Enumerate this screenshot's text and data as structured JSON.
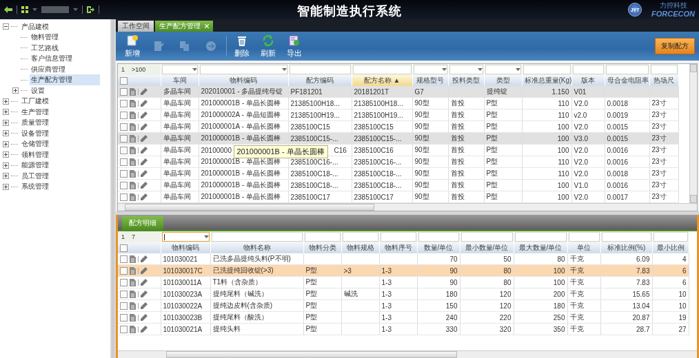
{
  "topbar": {
    "title": "智能制造执行系统",
    "logo_badge": "JYT",
    "brand_sub": "力控科技",
    "brand": "FORCECON"
  },
  "sidebar": {
    "items": [
      {
        "label": "产品建模",
        "expanded": true,
        "selected": false,
        "children": [
          {
            "label": "物料管理",
            "selected": false
          },
          {
            "label": "工艺路线",
            "selected": false
          },
          {
            "label": "客户信息管理",
            "selected": false
          },
          {
            "label": "供应商管理",
            "selected": false
          },
          {
            "label": "生产配方管理",
            "selected": true
          },
          {
            "label": "设置",
            "expanded": false,
            "selected": false
          }
        ]
      },
      {
        "label": "工厂建模",
        "expanded": false,
        "selected": false
      },
      {
        "label": "生产管理",
        "expanded": false,
        "selected": false
      },
      {
        "label": "质量管理",
        "expanded": false,
        "selected": false
      },
      {
        "label": "设备管理",
        "expanded": false,
        "selected": false
      },
      {
        "label": "仓储管理",
        "expanded": false,
        "selected": false
      },
      {
        "label": "领料管理",
        "expanded": false,
        "selected": false
      },
      {
        "label": "能源管理",
        "expanded": false,
        "selected": false
      },
      {
        "label": "员工管理",
        "expanded": false,
        "selected": false
      },
      {
        "label": "系统管理",
        "expanded": false,
        "selected": false
      }
    ]
  },
  "tabs": [
    {
      "label": "工作空间",
      "selected": false,
      "closable": false
    },
    {
      "label": "生产配方管理",
      "selected": true,
      "closable": true
    }
  ],
  "toolbar": {
    "buttons": [
      {
        "kind": "add",
        "label": "新增",
        "disabled": false
      },
      {
        "kind": "edit",
        "disabled": true
      },
      {
        "kind": "copy",
        "disabled": true
      },
      {
        "kind": "import",
        "disabled": true
      },
      {
        "kind": "delete",
        "label": "删除",
        "disabled": false
      },
      {
        "kind": "refresh",
        "label": "刷新",
        "disabled": false
      },
      {
        "kind": "export",
        "label": "导出",
        "disabled": false
      }
    ],
    "action": "复制配方"
  },
  "recipe_grid": {
    "all_checked": false,
    "pager": {
      "page": "1",
      "total": ">100"
    },
    "filters": [
      {
        "kind": "dropdown"
      },
      {
        "kind": "dropdown"
      },
      {
        "kind": "text"
      },
      {
        "kind": "text"
      },
      {
        "kind": "dropdown"
      },
      {
        "kind": "dropdown"
      },
      {
        "kind": "dropdown"
      },
      {
        "kind": "text"
      },
      {
        "kind": "text"
      },
      {
        "kind": "text"
      },
      {
        "kind": "text"
      }
    ],
    "columns": [
      {
        "label": "车间"
      },
      {
        "label": "物料编码"
      },
      {
        "label": "配方编码"
      },
      {
        "label": "配方名称",
        "sort_mark": "▲"
      },
      {
        "label": "规格型号"
      },
      {
        "label": "投料类型"
      },
      {
        "label": "类型"
      },
      {
        "label": "标准总重量(Kg)"
      },
      {
        "label": "版本"
      },
      {
        "label": "母合金电阻率"
      },
      {
        "label": "热场尺"
      }
    ],
    "rows": [
      {
        "checked": false,
        "selected": true,
        "cells": [
          "多晶车间",
          "202010001 - 多晶提纯母锭",
          "PF181201",
          "20181201T",
          "G7",
          "",
          "提纯锭",
          "1.150",
          "V01",
          "",
          ""
        ]
      },
      {
        "checked": false,
        "selected": false,
        "cells": [
          "单晶车间",
          "201000001B - 单晶长圆棒",
          "21385100H18...",
          "21385100H18...",
          "90型",
          "首投",
          "P型",
          "110",
          "V2.0",
          "0.0018",
          "23寸"
        ]
      },
      {
        "checked": false,
        "selected": false,
        "cells": [
          "单晶车间",
          "201000002A - 单晶短圆棒",
          "21385100H19...",
          "21385100H19...",
          "90型",
          "首投",
          "P型",
          "110",
          "v2.0",
          "0.0019",
          "23寸"
        ]
      },
      {
        "checked": false,
        "selected": false,
        "cells": [
          "单晶车间",
          "201000001A - 单晶长圆棒",
          "2385100C15",
          "2385100C15",
          "90型",
          "首投",
          "P型",
          "100",
          "V2.0",
          "0.0015",
          "23寸"
        ]
      },
      {
        "checked": false,
        "selected": true,
        "cells": [
          "单晶车间",
          "201000001B - 单晶长圆棒",
          "2385100C15-...",
          "2385100C15-...",
          "90型",
          "首投",
          "P型",
          "100",
          "V3.0",
          "0.0015",
          "23寸"
        ]
      },
      {
        "checked": false,
        "selected": false,
        "tooltip": "201000001B - 单晶长圆棒",
        "cells": [
          "单晶车间",
          "20100000",
          "C16",
          "2385100C16",
          "90型",
          "首投",
          "P型",
          "100",
          "V2.0",
          "0.0016",
          "23寸"
        ]
      },
      {
        "checked": false,
        "selected": false,
        "cells": [
          "单晶车间",
          "201000001B - 单晶长圆棒",
          "2385100C16-...",
          "2385100C16-...",
          "90型",
          "首投",
          "P型",
          "110",
          "V2.0",
          "0.0016",
          "23寸"
        ]
      },
      {
        "checked": false,
        "selected": false,
        "cells": [
          "单晶车间",
          "201000001B - 单晶长圆棒",
          "2385100C18-...",
          "2385100C18-...",
          "90型",
          "首投",
          "P型",
          "110",
          "V2.0",
          "0.0018",
          "23寸"
        ]
      },
      {
        "checked": false,
        "selected": false,
        "cells": [
          "单晶车间",
          "201000001B - 单晶长圆棒",
          "2385100C18-...",
          "2385100C18-...",
          "90型",
          "首投",
          "P型",
          "100",
          "V1.0",
          "0.0016",
          "23寸"
        ]
      },
      {
        "checked": false,
        "selected": false,
        "cells": [
          "单晶车间",
          "201000001B - 单晶长圆棒",
          "2385100C17",
          "2385100C17",
          "90型",
          "首投",
          "P型",
          "100",
          "V2.0",
          "0.0017",
          "23寸"
        ]
      }
    ]
  },
  "detail": {
    "tab": "配方明细",
    "grid": {
      "all_checked": false,
      "pager": {
        "page": "1",
        "total": "7"
      },
      "filters": [
        {
          "kind": "dropdown",
          "focused": true
        },
        {
          "kind": "text"
        },
        {
          "kind": "text"
        },
        {
          "kind": "text"
        },
        {
          "kind": "text"
        },
        {
          "kind": "text"
        },
        {
          "kind": "text"
        },
        {
          "kind": "text"
        },
        {
          "kind": "text"
        },
        {
          "kind": "text"
        },
        {
          "kind": "text"
        }
      ],
      "columns": [
        {
          "label": "物料编码"
        },
        {
          "label": "物料名称"
        },
        {
          "label": "物料分类"
        },
        {
          "label": "物料规格"
        },
        {
          "label": "物料序号"
        },
        {
          "label": "数量/单位"
        },
        {
          "label": "最小数量/单位"
        },
        {
          "label": "最大数量/单位"
        },
        {
          "label": "单位"
        },
        {
          "label": "标准比例(%)"
        },
        {
          "label": "最小比例"
        }
      ],
      "rows": [
        {
          "checked": false,
          "selected": false,
          "cells": [
            "101030021",
            "已洗多晶提纯头料(P不明)",
            "",
            "",
            "",
            "70",
            "50",
            "80",
            "千克",
            "6.09",
            "4"
          ]
        },
        {
          "checked": false,
          "selected": true,
          "cells": [
            "101030017C",
            "已洗提纯回收锭(>3)",
            "P型",
            ">3",
            "1-3",
            "90",
            "80",
            "100",
            "千克",
            "7.83",
            "6"
          ]
        },
        {
          "checked": false,
          "selected": false,
          "cells": [
            "101030011A",
            "T1料（含杂质）",
            "P型",
            "",
            "1-3",
            "90",
            "80",
            "100",
            "千克",
            "7.83",
            "6"
          ]
        },
        {
          "checked": false,
          "selected": false,
          "cells": [
            "101030023A",
            "提纯尾料（碱洗）",
            "P型",
            "碱洗",
            "1-3",
            "180",
            "120",
            "200",
            "千克",
            "15.65",
            "10"
          ]
        },
        {
          "checked": false,
          "selected": false,
          "cells": [
            "101030022A",
            "提纯边皮料(含杂质)",
            "P型",
            "",
            "1-3",
            "150",
            "120",
            "180",
            "千克",
            "13.04",
            "10"
          ]
        },
        {
          "checked": false,
          "selected": false,
          "cells": [
            "101030023B",
            "提纯尾料（酸洗）",
            "P型",
            "",
            "1-3",
            "240",
            "220",
            "250",
            "千克",
            "20.87",
            "19"
          ]
        },
        {
          "checked": false,
          "selected": false,
          "cells": [
            "101030021A",
            "提纯头料",
            "P型",
            "",
            "1-3",
            "330",
            "320",
            "350",
            "千克",
            "28.7",
            "27"
          ]
        }
      ]
    }
  }
}
